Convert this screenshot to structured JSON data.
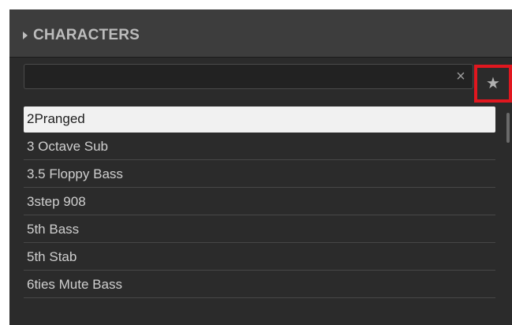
{
  "header": {
    "title": "CHARACTERS"
  },
  "search": {
    "value": "",
    "placeholder": "",
    "clear_symbol": "×"
  },
  "favorites": {
    "symbol": "★",
    "highlight_color": "#e0171f"
  },
  "list": {
    "items": [
      {
        "label": "2Pranged",
        "selected": true
      },
      {
        "label": "3 Octave Sub",
        "selected": false
      },
      {
        "label": "3.5 Floppy Bass",
        "selected": false
      },
      {
        "label": "3step 908",
        "selected": false
      },
      {
        "label": "5th Bass",
        "selected": false
      },
      {
        "label": "5th Stab",
        "selected": false
      },
      {
        "label": "6ties Mute Bass",
        "selected": false
      }
    ]
  }
}
